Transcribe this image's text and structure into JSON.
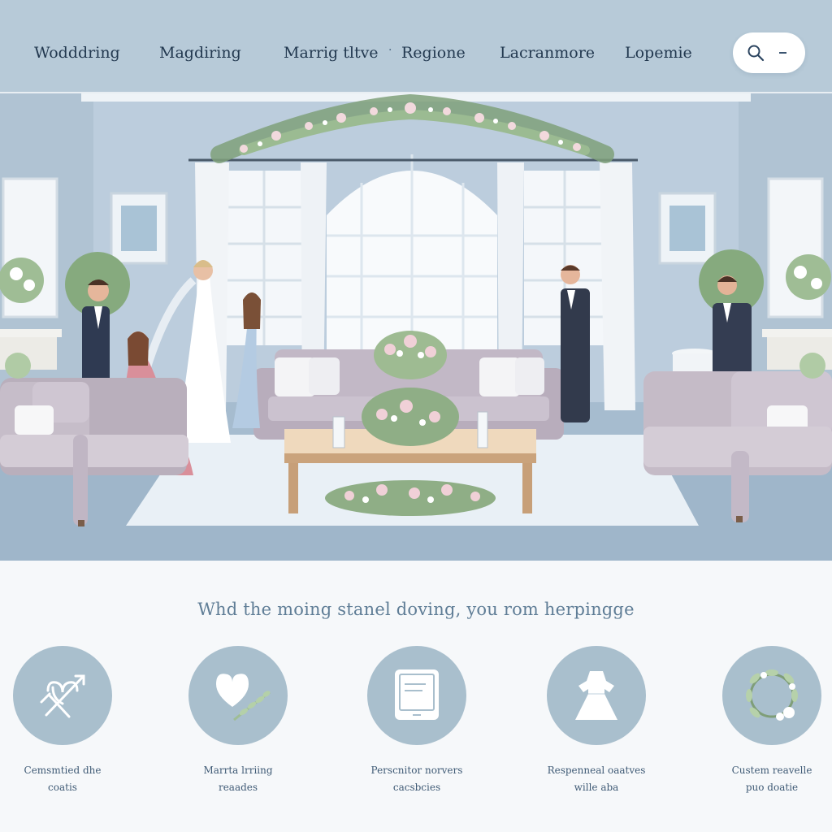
{
  "nav": {
    "items": [
      {
        "label": "Wodddring"
      },
      {
        "label": "Magdiring"
      },
      {
        "label": "Marrig tltve"
      },
      {
        "label": "Regione"
      },
      {
        "label": "Lacranmore"
      },
      {
        "label": "Lopemie"
      }
    ],
    "separator": "·",
    "search": {
      "icon": "search-icon",
      "extra": "-"
    }
  },
  "tagline": "Whd the moing stanel doving,  you rom herpingge",
  "features": [
    {
      "icon": "crossed-hearts-icon",
      "line1": "Cemsmtied dhe",
      "line2": "coatis"
    },
    {
      "icon": "heart-leaf-icon",
      "line1": "Marrta lrriing",
      "line2": "reaades"
    },
    {
      "icon": "tablet-icon",
      "line1": "Perscnitor norvers",
      "line2": "cacsbcies"
    },
    {
      "icon": "dress-icon",
      "line1": "Respenneal oaatves",
      "line2": "wille aba"
    },
    {
      "icon": "wreath-icon",
      "line1": "Custem reavelle",
      "line2": "puo doatie"
    }
  ],
  "colors": {
    "nav_bg": "#b7cad8",
    "hero_wall": "#b9cbdc",
    "icon_circle": "#a9bfcd",
    "accent_text": "#5f7d96"
  }
}
